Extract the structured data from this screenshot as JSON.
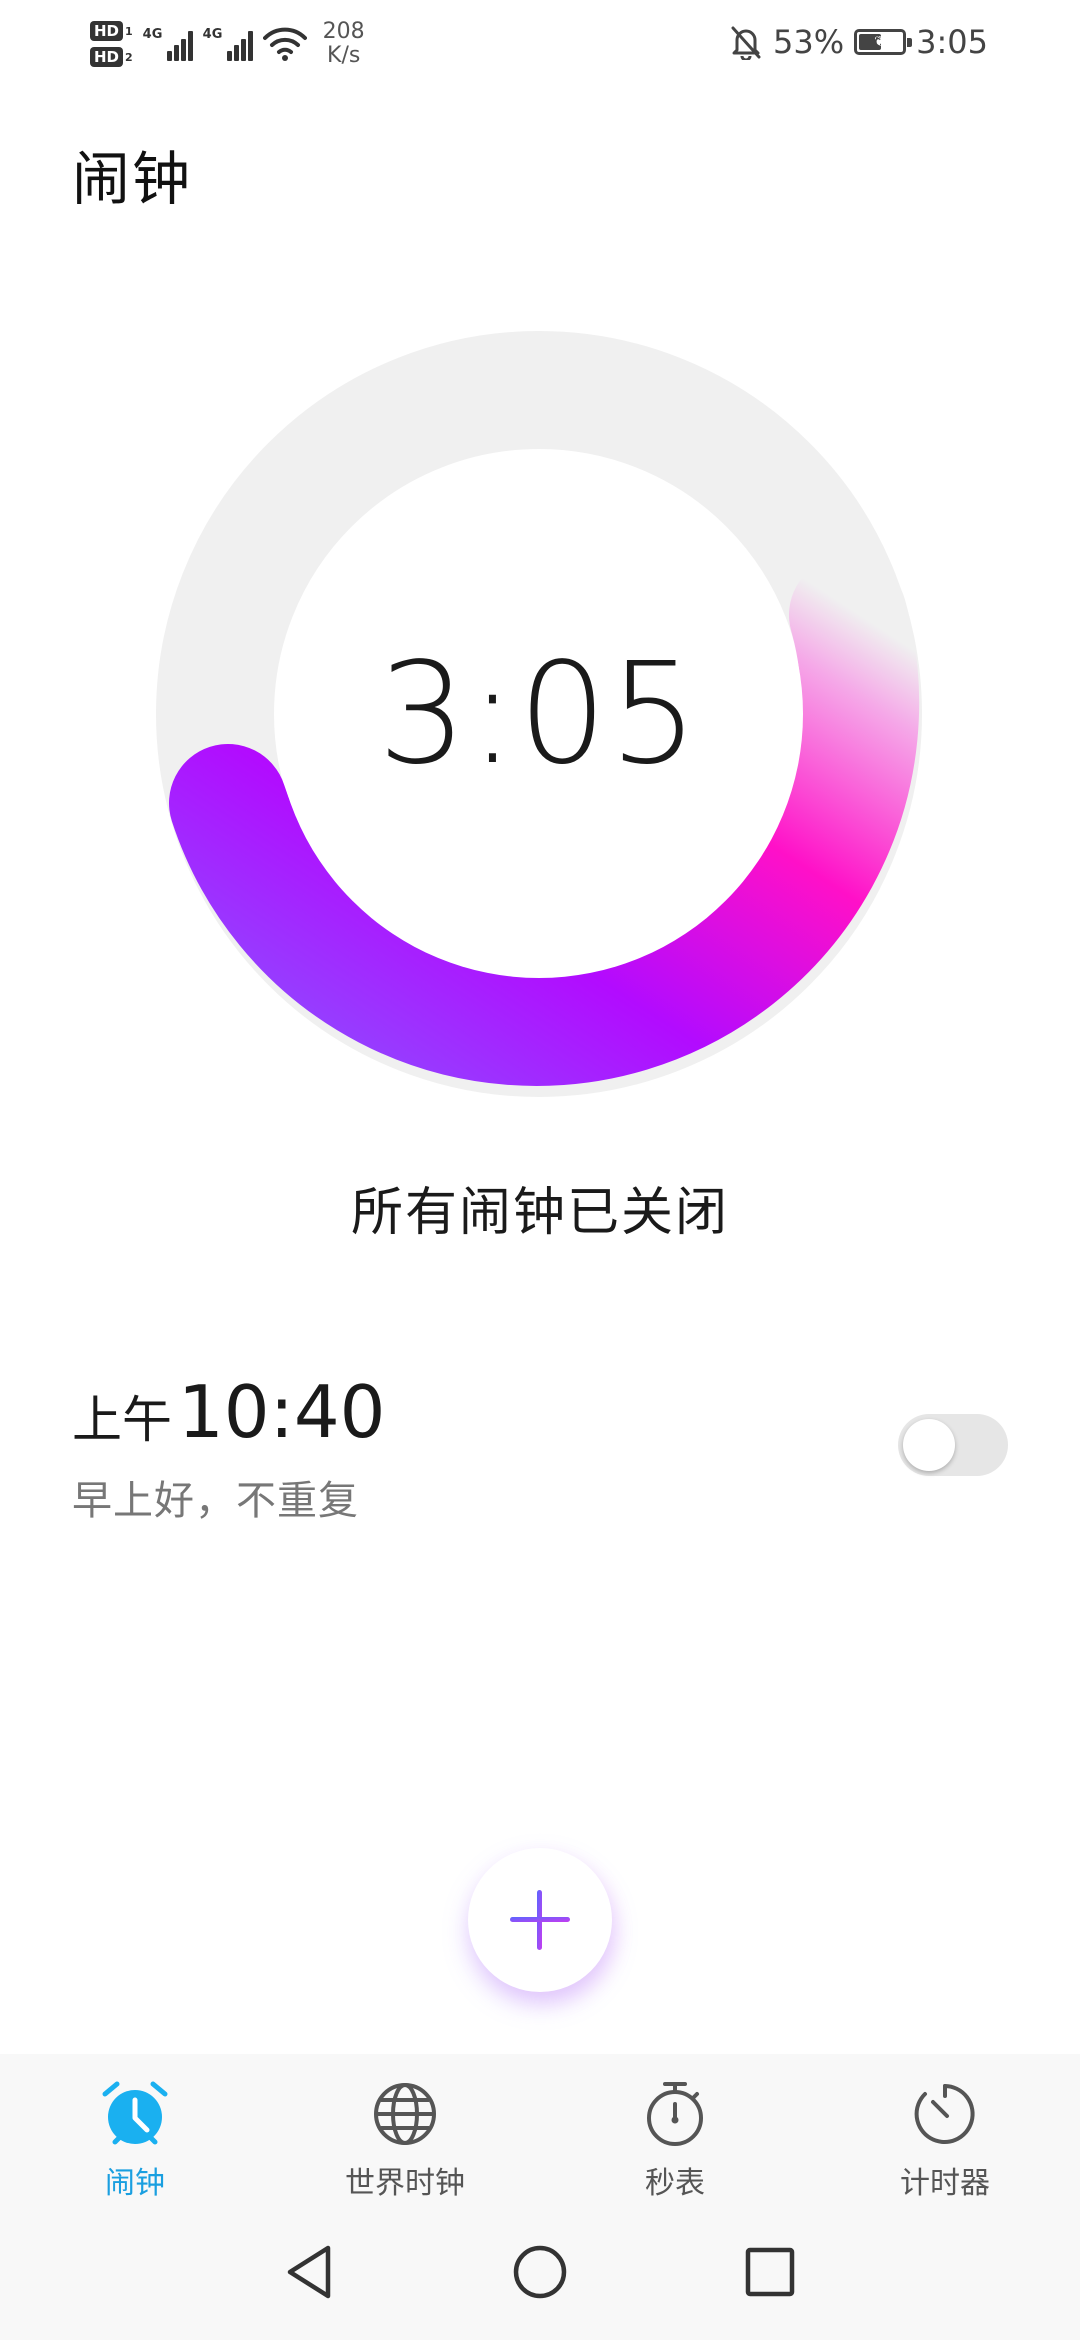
{
  "status_bar": {
    "hd1": "HD",
    "hd1_sim": "1",
    "hd2": "HD",
    "hd2_sim": "2",
    "sim1_type": "4G",
    "sim2_type": "4G",
    "net_speed_value": "208",
    "net_speed_unit": "K/s",
    "battery_percent": "53%",
    "battery_level": 0.53,
    "time": "3:05",
    "icons": [
      "hd-icon",
      "signal-icon",
      "wifi-icon",
      "bell-off-icon",
      "battery-icon"
    ]
  },
  "header": {
    "title": "闹钟"
  },
  "clock": {
    "time": "3:05",
    "ring_colors": [
      "#8e4cff",
      "#b20bff",
      "#ff10c8",
      "#f5a8e8",
      "#f0f0f0"
    ]
  },
  "status_message": "所有闹钟已关闭",
  "alarms": [
    {
      "ampm": "上午",
      "time": "10:40",
      "label": "早上好，不重复",
      "enabled": false
    }
  ],
  "fab": {
    "icon": "plus-icon"
  },
  "bottom_nav": {
    "active_color": "#1a9fe0",
    "items": [
      {
        "label": "闹钟",
        "icon": "alarm-clock-icon",
        "active": true
      },
      {
        "label": "世界时钟",
        "icon": "globe-icon",
        "active": false
      },
      {
        "label": "秒表",
        "icon": "stopwatch-icon",
        "active": false
      },
      {
        "label": "计时器",
        "icon": "timer-icon",
        "active": false
      }
    ]
  },
  "system_nav": {
    "icons": [
      "back-triangle-icon",
      "home-circle-icon",
      "recents-square-icon"
    ]
  }
}
